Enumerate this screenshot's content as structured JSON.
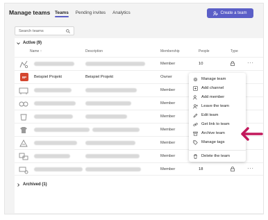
{
  "header": {
    "title": "Manage teams"
  },
  "tabs": [
    {
      "label": "Teams",
      "active": true
    },
    {
      "label": "Pending invites",
      "active": false
    },
    {
      "label": "Analytics",
      "active": false
    }
  ],
  "create_button": {
    "label": "Create a team"
  },
  "search": {
    "placeholder": "Search teams"
  },
  "sections": {
    "active": {
      "label": "Active (9)"
    },
    "archived": {
      "label": "Archived (1)"
    }
  },
  "columns": {
    "name": "Name",
    "description": "Description",
    "membership": "Membership",
    "people": "People",
    "type": "Type"
  },
  "rows": [
    {
      "name": "",
      "description": "",
      "membership": "Member",
      "people": "10",
      "icon": "team-avatar-icon"
    },
    {
      "name": "Beispiel Projekt",
      "description": "Beispiel Projekt",
      "membership": "Owner",
      "people": "",
      "avatar_initials": "BP"
    },
    {
      "name": "",
      "description": "",
      "membership": "Member",
      "people": "",
      "icon": "team-avatar-icon"
    },
    {
      "name": "",
      "description": "",
      "membership": "Member",
      "people": "",
      "icon": "team-avatar-icon"
    },
    {
      "name": "",
      "description": "",
      "membership": "Member",
      "people": "",
      "icon": "team-avatar-icon"
    },
    {
      "name": "",
      "description": "",
      "membership": "Member",
      "people": "",
      "icon": "team-avatar-icon"
    },
    {
      "name": "",
      "description": "",
      "membership": "Member",
      "people": "",
      "icon": "team-avatar-icon"
    },
    {
      "name": "",
      "description": "",
      "membership": "Member",
      "people": "",
      "icon": "team-avatar-icon"
    },
    {
      "name": "",
      "description": "",
      "membership": "Member",
      "people": "18",
      "icon": "team-avatar-icon"
    }
  ],
  "more_glyph": "···",
  "context_menu": {
    "items": [
      {
        "label": "Manage team",
        "icon": "gear-icon"
      },
      {
        "label": "Add channel",
        "icon": "channel-icon"
      },
      {
        "label": "Add member",
        "icon": "add-member-icon"
      },
      {
        "label": "Leave the team",
        "icon": "leave-icon"
      },
      {
        "label": "Edit team",
        "icon": "pencil-icon"
      },
      {
        "label": "Get link to team",
        "icon": "link-icon"
      },
      {
        "label": "Archive team",
        "icon": "archive-icon"
      },
      {
        "label": "Manage tags",
        "icon": "tag-icon"
      },
      {
        "label": "Delete the team",
        "icon": "trash-icon"
      }
    ]
  },
  "colors": {
    "accent": "#5b5fc7",
    "annotation_arrow": "#c2185b",
    "avatar_bp": "#d4462f"
  }
}
